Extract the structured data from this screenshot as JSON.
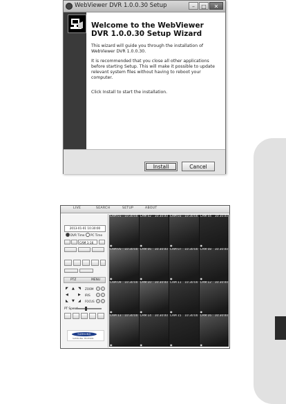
{
  "setup": {
    "title": "WebViewer DVR 1.0.0.30 Setup",
    "heading": "Welcome to the WebViewer DVR 1.0.0.30 Setup Wizard",
    "para1": "This wizard will guide you through the installation of WebViewer DVR 1.0.0.30.",
    "para2": "It is recommended that you close all other applications before starting Setup. This will make it possible to update relevant system files without having to reboot your computer.",
    "para3": "Click Install to start the installation.",
    "install": "Install",
    "cancel": "Cancel",
    "window_buttons": {
      "minimize": "–",
      "maximize": "□",
      "close": "✕"
    }
  },
  "viewer": {
    "menu": [
      "LIVE",
      "SEARCH",
      "SETUP",
      "ABOUT"
    ],
    "datetime": "2013-01-01 10:30:00",
    "time_options": [
      "DVR Time",
      "PC Time"
    ],
    "channel": "CAM 1-16",
    "ptz_label": "PTZ",
    "menu_label": "MENU",
    "zoom_label": "ZOOM",
    "iris_label": "IRIS",
    "focus_label": "FOCUS",
    "speed_label": "PT Speed",
    "brand": "SAMSUNG",
    "brand_sub": "SAMSUNG TECHWIN",
    "cameras": [
      {
        "label": "CAM 01",
        "time": "10:30:00"
      },
      {
        "label": "CAM 02",
        "time": "10:30:00"
      },
      {
        "label": "CAM 03",
        "time": "10:30:00"
      },
      {
        "label": "CAM 04",
        "time": "10:30:00"
      },
      {
        "label": "CAM 05",
        "time": "10:30:00"
      },
      {
        "label": "CAM 06",
        "time": "10:30:00"
      },
      {
        "label": "CAM 07",
        "time": "10:30:00"
      },
      {
        "label": "CAM 08",
        "time": "10:30:00"
      },
      {
        "label": "CAM 09",
        "time": "10:30:00"
      },
      {
        "label": "CAM 10",
        "time": "10:30:00"
      },
      {
        "label": "CAM 11",
        "time": "10:30:00"
      },
      {
        "label": "CAM 12",
        "time": "10:30:00"
      },
      {
        "label": "CAM 13",
        "time": "10:30:00"
      },
      {
        "label": "CAM 14",
        "time": "10:30:00"
      },
      {
        "label": "CAM 15",
        "time": "10:30:00"
      },
      {
        "label": "CAM 16",
        "time": "10:30:00"
      }
    ]
  }
}
